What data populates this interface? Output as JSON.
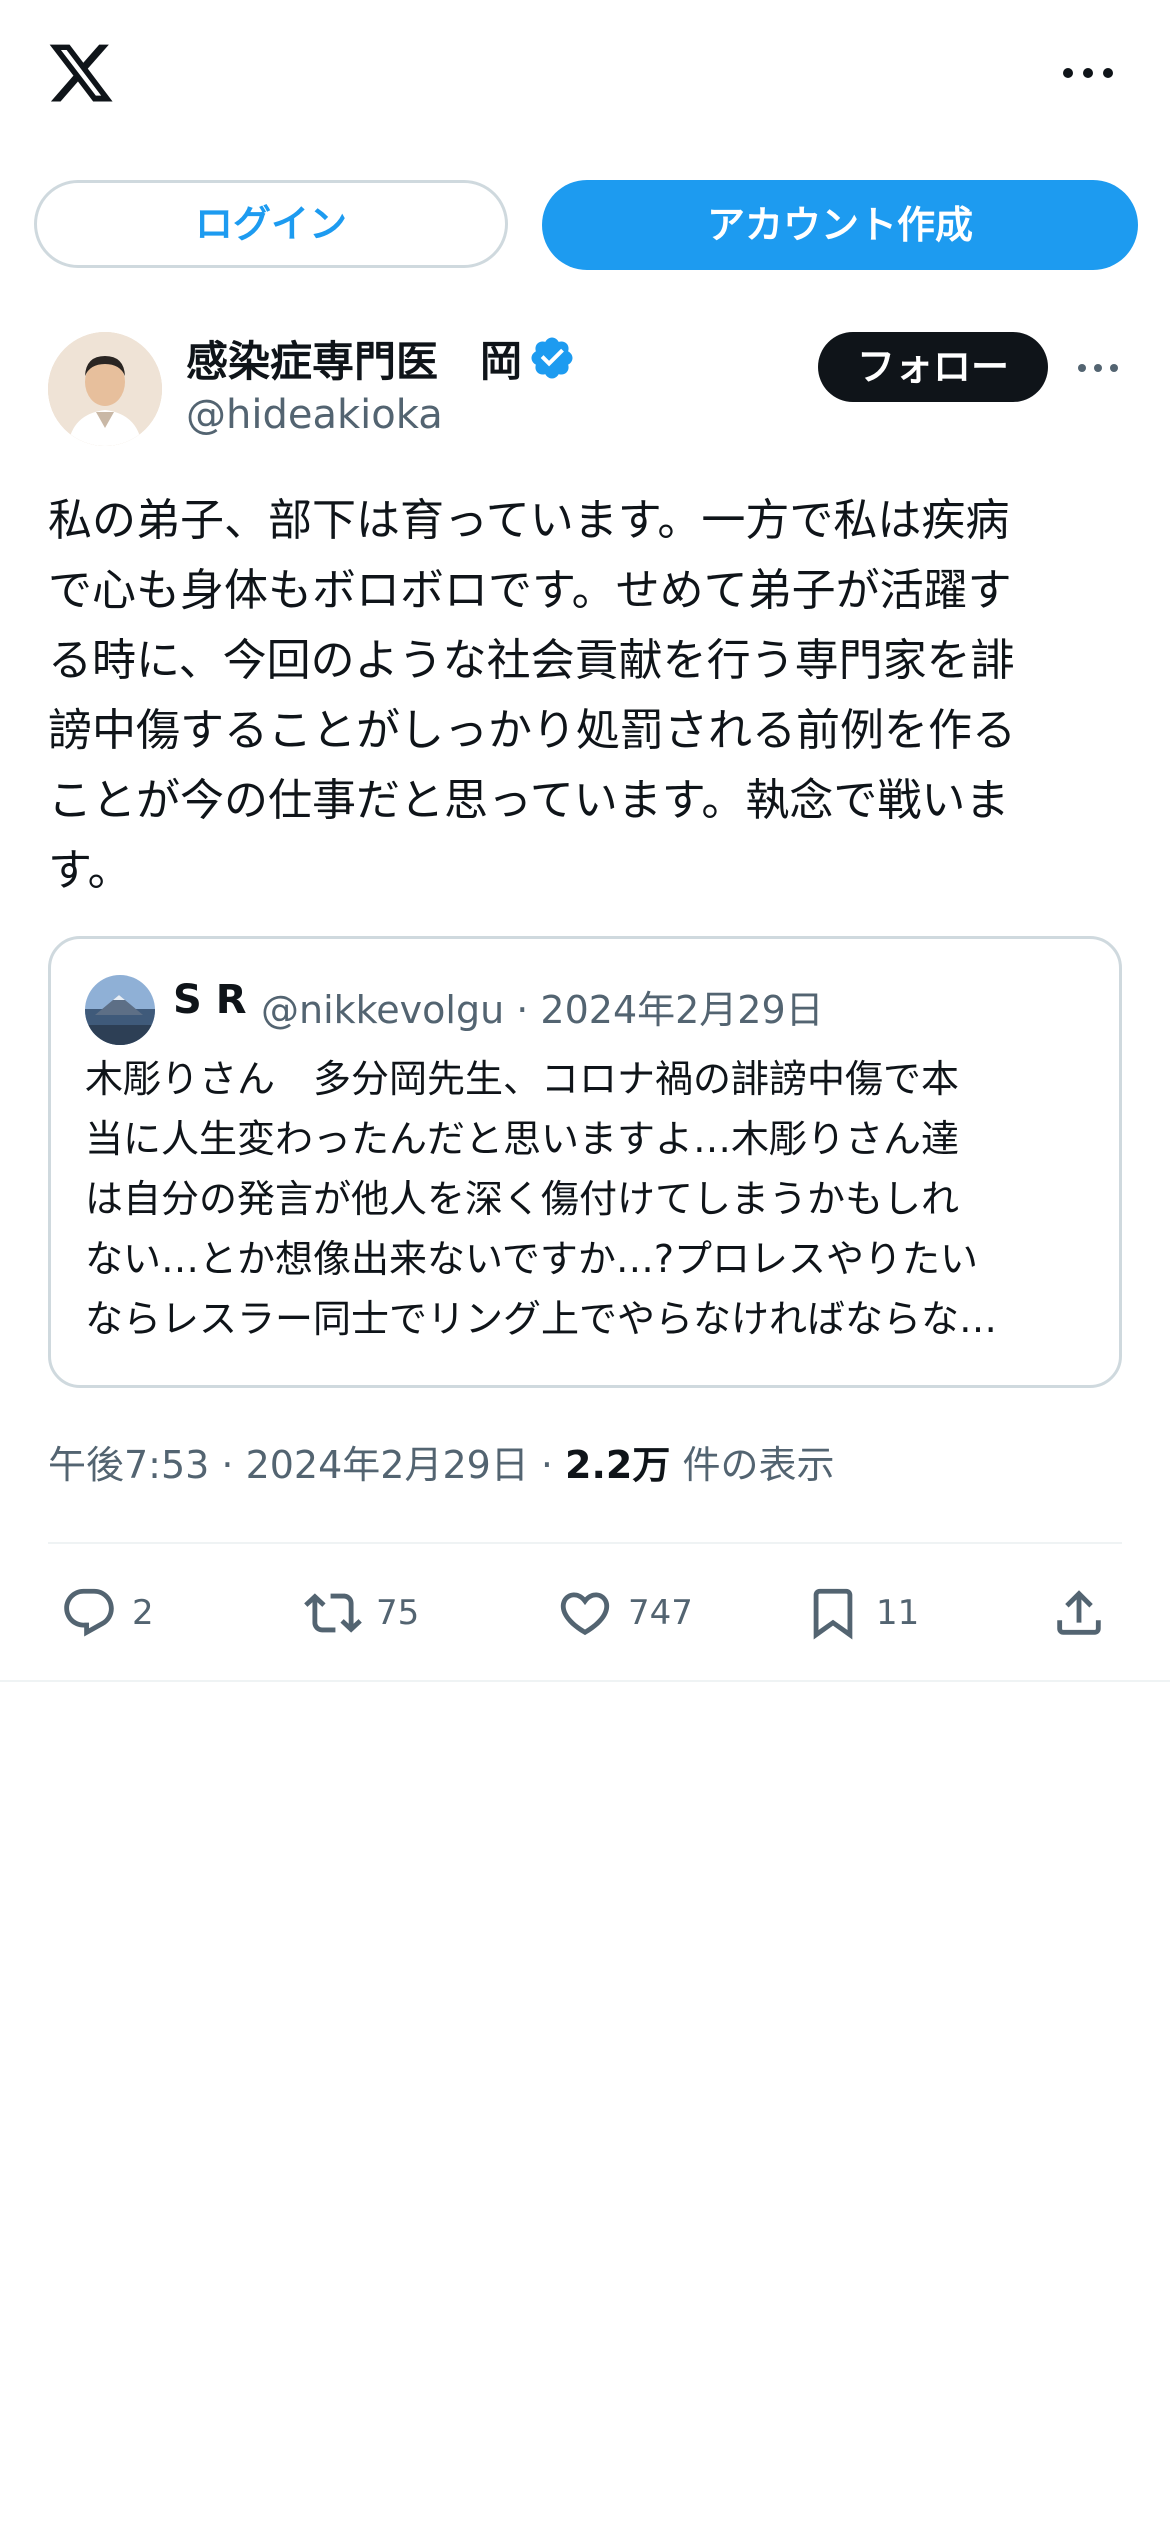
{
  "header": {
    "logo_icon": "x-logo-icon",
    "more_icon": "more-horizontal-icon"
  },
  "auth": {
    "login_label": "ログイン",
    "signup_label": "アカウント作成"
  },
  "author": {
    "display_name": "感染症専門医　岡",
    "handle": "@hideakioka",
    "verified": true,
    "follow_label": "フォロー"
  },
  "tweet": {
    "text": "私の弟子、部下は育っています。一方で私は疾病\nで心も身体もボロボロです。せめて弟子が活躍す\nる時に、今回のような社会貢献を行う専門家を誹\n謗中傷することがしっかり処罰される前例を作る\nことが今の仕事だと思っています。執念で戦いま\nす。"
  },
  "quote": {
    "name": "S R",
    "meta": "@nikkevolgu · 2024年2月29日",
    "text": "木彫りさん　多分岡先生、コロナ禍の誹謗中傷で本\n当に人生変わったんだと思いますよ…木彫りさん達\nは自分の発言が他人を深く傷付けてしまうかもしれ\nない…とか想像出来ないですか…?プロレスやりたい\nならレスラー同士でリング上でやらなければならな…"
  },
  "meta": {
    "time_date": "午後7:53 · 2024年2月29日 · ",
    "views_count": "2.2万",
    "views_label": " 件の表示"
  },
  "actions": {
    "replies": "2",
    "retweets": "75",
    "likes": "747",
    "bookmarks": "11"
  },
  "colors": {
    "accent": "#1d9bf0",
    "text": "#0f1419",
    "secondary": "#536471",
    "border": "#cfd9de"
  }
}
